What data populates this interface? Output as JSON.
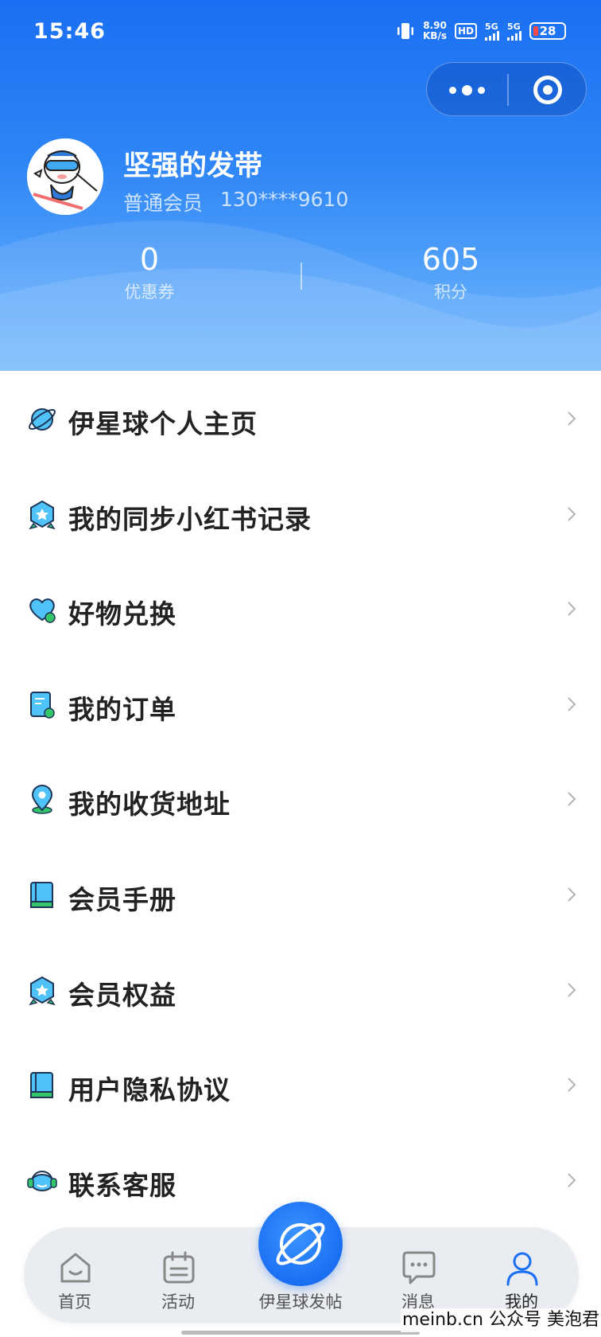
{
  "status_bar": {
    "time": "15:46",
    "net_speed_value": "8.90",
    "net_speed_unit": "KB/s",
    "hd_label": "HD",
    "sim1": "5G",
    "sim2": "5G",
    "battery": "28"
  },
  "profile": {
    "username": "坚强的发带",
    "member_level": "普通会员",
    "phone": "130****9610"
  },
  "stats": [
    {
      "value": "0",
      "label": "优惠券"
    },
    {
      "value": "605",
      "label": "积分"
    }
  ],
  "menu": [
    {
      "label": "伊星球个人主页",
      "icon": "planet-icon"
    },
    {
      "label": "我的同步小红书记录",
      "icon": "badge-icon"
    },
    {
      "label": "好物兑换",
      "icon": "heart-icon"
    },
    {
      "label": "我的订单",
      "icon": "order-icon"
    },
    {
      "label": "我的收货地址",
      "icon": "location-icon"
    },
    {
      "label": "会员手册",
      "icon": "book-icon"
    },
    {
      "label": "会员权益",
      "icon": "badge-icon"
    },
    {
      "label": "用户隐私协议",
      "icon": "book-icon"
    },
    {
      "label": "联系客服",
      "icon": "headset-icon"
    }
  ],
  "tabbar": {
    "home": "首页",
    "activity": "活动",
    "post": "伊星球发帖",
    "messages": "消息",
    "mine": "我的"
  },
  "watermark": "meinb.cn  公众号 美泡君",
  "colors": {
    "brand_blue": "#1a6ff2",
    "icon_teal": "#4fc3f7",
    "icon_green": "#34c76a"
  }
}
